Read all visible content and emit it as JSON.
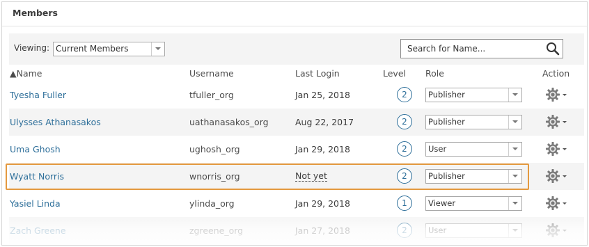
{
  "panel": {
    "title": "Members"
  },
  "filter": {
    "viewing_label": "Viewing:",
    "viewing_value": "Current Members",
    "search_placeholder": "Search for Name..."
  },
  "table": {
    "headers": {
      "name": "▲Name",
      "username": "Username",
      "last_login": "Last Login",
      "level": "Level",
      "role": "Role",
      "action": "Action"
    },
    "rows": [
      {
        "name": "Tyesha Fuller",
        "username": "tfuller_org",
        "last_login": "Jan 25, 2018",
        "level": "2",
        "role": "Publisher"
      },
      {
        "name": "Ulysses Athanasakos",
        "username": "uathanasakos_org",
        "last_login": "Aug 22, 2017",
        "level": "2",
        "role": "Publisher"
      },
      {
        "name": "Uma Ghosh",
        "username": "ughosh_org",
        "last_login": "Jan 29, 2018",
        "level": "2",
        "role": "User"
      },
      {
        "name": "Wyatt Norris",
        "username": "wnorris_org",
        "last_login": "Not yet",
        "level": "2",
        "role": "Publisher",
        "highlighted": true
      },
      {
        "name": "Yasiel Linda",
        "username": "ylinda_org",
        "last_login": "Jan 29, 2018",
        "level": "1",
        "role": "Viewer"
      },
      {
        "name": "Zach Greene",
        "username": "zgreene_org",
        "last_login": "Jan 27, 2018",
        "level": "2",
        "role": "User"
      }
    ]
  },
  "colors": {
    "link": "#2e6f9a",
    "highlight_border": "#e4993f",
    "alt_row_bg": "#f4f4f4"
  },
  "icons": {
    "search": "search-icon",
    "action": "gear-icon",
    "sort": "sort-ascending-icon"
  }
}
